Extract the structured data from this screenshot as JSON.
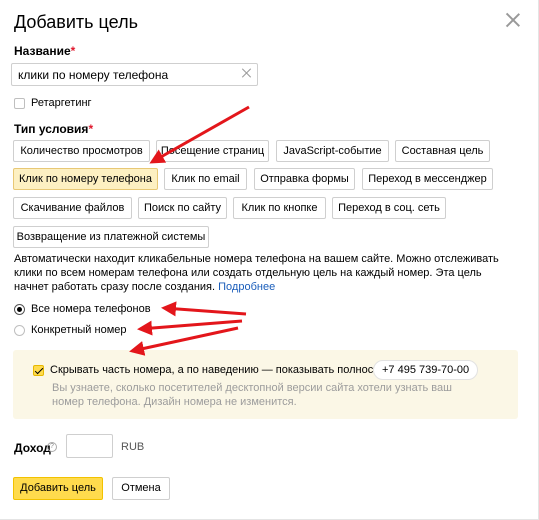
{
  "dialog": {
    "title": "Добавить цель",
    "name_label": "Название",
    "required_mark": "*",
    "name_value": "клики по номеру телефона",
    "retargeting_label": "Ретаргетинг",
    "condition_label": "Тип условия",
    "condition_types": [
      "Количество просмотров",
      "Посещение страниц",
      "JavaScript-событие",
      "Составная цель",
      "Клик по номеру телефона",
      "Клик по email",
      "Отправка формы",
      "Переход в мессенджер",
      "Скачивание файлов",
      "Поиск по сайту",
      "Клик по кнопке",
      "Переход в соц. сеть",
      "Возвращение из платежной системы"
    ],
    "active_condition": "Клик по номеру телефона",
    "description": "Автоматически находит кликабельные номера телефона на вашем сайте. Можно отслеживать клики по всем номерам телефона или создать отдельную цель на каждый номер. Эта цель начнет работать сразу после создания.",
    "details_link": "Подробнее",
    "radio_options": [
      "Все номера телефонов",
      "Конкретный номер"
    ],
    "selected_radio": "Все номера телефонов",
    "hide_number_label": "Скрывать часть номера, а по наведению — показывать полностью:",
    "phone_example": "+7 495 739-70-00",
    "hide_number_hint": "Вы узнаете, сколько посетителей десктопной версии сайта хотели узнать ваш номер телефона. Дизайн номера не изменится.",
    "income_label": "Доход",
    "income_help": "?",
    "income_value": "",
    "currency": "RUB",
    "submit_label": "Добавить цель",
    "cancel_label": "Отмена"
  },
  "colors": {
    "accent_yellow": "#ffdb4d",
    "active_chip": "#fdf0c2",
    "note_background": "#fbf7e6",
    "link": "#1a5dba",
    "required": "#e0182d",
    "annotation_arrow": "#e3161b"
  },
  "icons": {
    "close": "close-icon",
    "clear": "clear-icon",
    "help": "question-icon",
    "arrows": "red-annotation-arrow"
  }
}
